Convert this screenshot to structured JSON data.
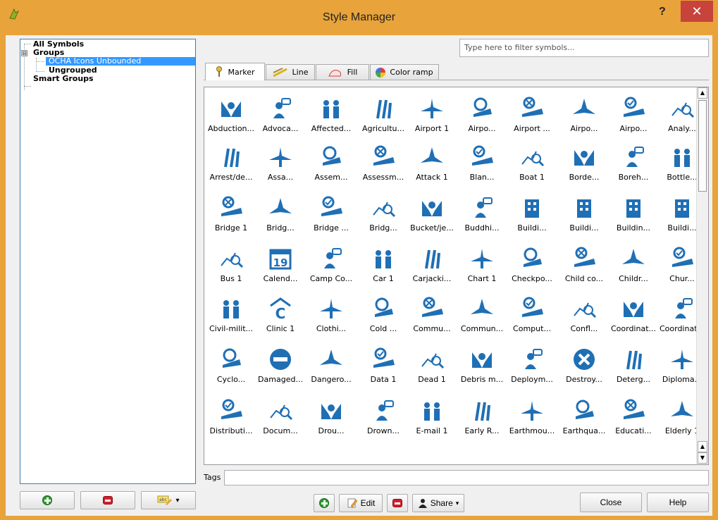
{
  "window": {
    "title": "Style Manager",
    "help_label": "?",
    "close_label": "✕"
  },
  "tree": {
    "all_symbols": "All Symbols",
    "groups": "Groups",
    "ocha": "OCHA Icons Unbounded",
    "ungrouped": "Ungrouped",
    "smart_groups": "Smart Groups",
    "expander": "⊟"
  },
  "filter": {
    "placeholder": "Type here to filter symbols..."
  },
  "tabs": [
    {
      "label": "Marker",
      "icon": "marker-pin-icon"
    },
    {
      "label": "Line",
      "icon": "line-icon"
    },
    {
      "label": "Fill",
      "icon": "fill-icon"
    },
    {
      "label": "Color ramp",
      "icon": "color-ramp-icon"
    }
  ],
  "symbols": [
    [
      "Abduction...",
      "Advoca...",
      "Affected...",
      "Agricultu...",
      "Airport 1",
      "Airpo...",
      "Airport ...",
      "Airpo...",
      "Airpo...",
      "Analy..."
    ],
    [
      "Arrest/de...",
      "Assa...",
      "Assem...",
      "Assessm...",
      "Attack 1",
      "Blan...",
      "Boat 1",
      "Borde...",
      "Boreh...",
      "Bottle..."
    ],
    [
      "Bridge 1",
      "Bridg...",
      "Bridge ...",
      "Bridg...",
      "Bucket/je...",
      "Buddhi...",
      "Buildi...",
      "Buildi...",
      "Buildin...",
      "Buildi..."
    ],
    [
      "Bus 1",
      "Calend...",
      "Camp Co...",
      "Car 1",
      "Carjacki...",
      "Chart 1",
      "Checkpo...",
      "Child co...",
      "Childr...",
      "Chur..."
    ],
    [
      "Civil-milit...",
      "Clinic 1",
      "Clothi...",
      "Cold ...",
      "Commu...",
      "Commun...",
      "Comput...",
      "Confl...",
      "Coordinat...",
      "Coordinat..."
    ],
    [
      "Cyclo...",
      "Damaged...",
      "Dangero...",
      "Data 1",
      "Dead 1",
      "Debris m...",
      "Deploym...",
      "Destroy...",
      "Deterg...",
      "Diploma..."
    ],
    [
      "Distributi...",
      "Docum...",
      "Drou...",
      "Drown...",
      "E-mail 1",
      "Early R...",
      "Earthmou...",
      "Earthqua...",
      "Educati...",
      "Elderly 1"
    ]
  ],
  "calendar_number": "19",
  "tags": {
    "label": "Tags",
    "value": ""
  },
  "buttons": {
    "edit": "Edit",
    "share": "Share",
    "close": "Close",
    "help": "Help",
    "dropdown": "▾",
    "scroll_up": "▲",
    "scroll_down": "▼"
  },
  "colors": {
    "icon_blue": "#1f6fb5",
    "selection": "#3399ff",
    "title_bar": "#e8a33a",
    "close_red": "#c7433b"
  }
}
